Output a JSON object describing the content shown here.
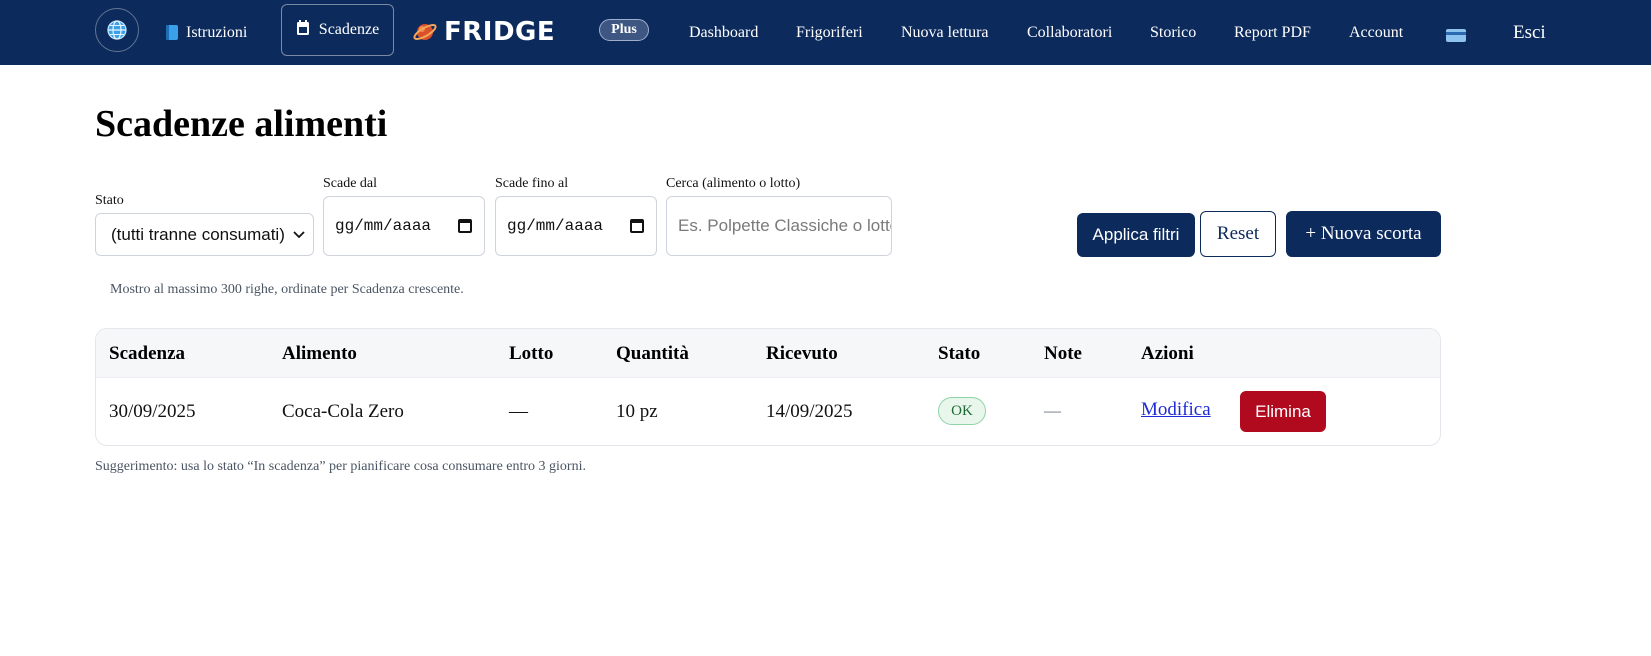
{
  "nav": {
    "istruzioni": "Istruzioni",
    "scadenze": "Scadenze",
    "logo_text": "FRIDGE",
    "plus": "Plus",
    "links": [
      "Dashboard",
      "Frigoriferi",
      "Nuova lettura",
      "Collaboratori",
      "Storico",
      "Report PDF",
      "Account"
    ],
    "esci": "Esci"
  },
  "page": {
    "title": "Scadenze alimenti"
  },
  "filters": {
    "stato_label": "Stato",
    "stato_value": "(tutti tranne consumati)",
    "from_label": "Scade dal",
    "from_value": "gg/mm/aaaa",
    "to_label": "Scade fino al",
    "to_value": "gg/mm/aaaa",
    "search_label": "Cerca (alimento o lotto)",
    "search_placeholder": "Es. Polpette Classiche o lotto",
    "apply": "Applica filtri",
    "reset": "Reset",
    "new": "+ Nuova scorta"
  },
  "info": "Mostro al massimo 300 righe, ordinate per Scadenza crescente.",
  "table": {
    "headers": [
      "Scadenza",
      "Alimento",
      "Lotto",
      "Quantità",
      "Ricevuto",
      "Stato",
      "Note",
      "Azioni"
    ],
    "rows": [
      {
        "scadenza": "30/09/2025",
        "alimento": "Coca-Cola Zero",
        "lotto": "—",
        "quantita": "10 pz",
        "ricevuto": "14/09/2025",
        "stato": "OK",
        "note": "—",
        "modifica": "Modifica",
        "elimina": "Elimina"
      }
    ]
  },
  "tip": "Suggerimento: usa lo stato “In scadenza” per pianificare cosa consumare entro 3 giorni.",
  "colors": {
    "navy": "#0d2a5c",
    "danger": "#b10a1f",
    "ok_bg": "#e8f6ec",
    "ok_text": "#1e6a36"
  }
}
